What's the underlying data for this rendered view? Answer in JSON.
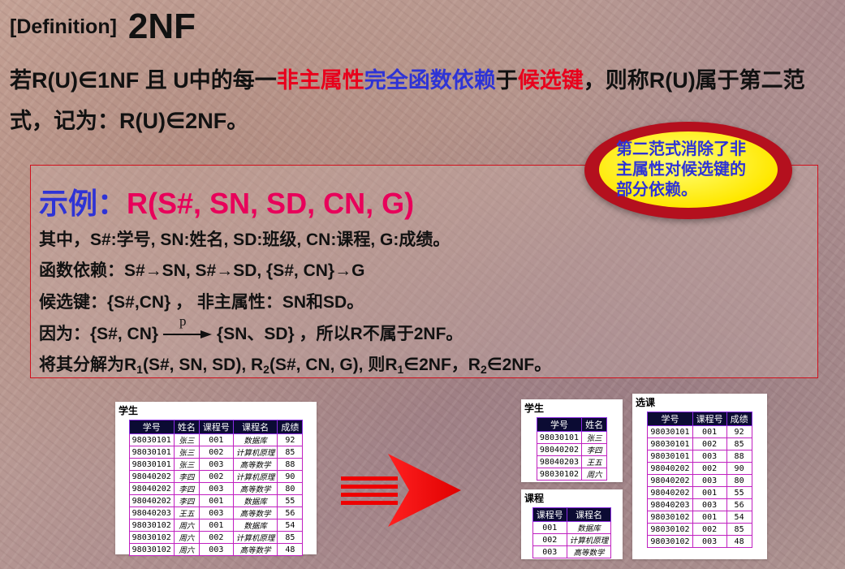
{
  "title": {
    "tag": "[Definition]",
    "name": "2NF"
  },
  "definition": {
    "p1": "若R(U)∈1NF 且 U中的每一",
    "p2": "非主属性",
    "p3": "完全函数依赖",
    "p4": "于",
    "p5": "候选键",
    "p6": "，则称R(U)属于第二范式，记为：R(U)∈2NF。"
  },
  "bubble": {
    "text": "第二范式消除了非主属性对候选键的部分依赖。"
  },
  "example": {
    "lead": "示例：",
    "relation": "R(S#, SN, SD, CN, G)",
    "line1": "其中，S#:学号, SN:姓名, SD:班级, CN:课程, G:成绩。",
    "line2": "函数依赖：S#→SN,  S#→SD, {S#, CN}→G",
    "line3": "候选键：{S#,CN} ， 非主属性：SN和SD。",
    "line4_a": "因为：{S#, CN}",
    "line4_p": "p",
    "line4_b": "{SN、SD} ，所以R不属于2NF。",
    "line5": {
      "a": "将其分解为R",
      "s1": "1",
      "b": "(S#, SN, SD), R",
      "s2": "2",
      "c": "(S#, CN, G), 则R",
      "s3": "1",
      "d": "∈2NF，R",
      "s4": "2",
      "e": "∈2NF。"
    }
  },
  "table_student": {
    "caption": "学生",
    "headers": [
      "学号",
      "姓名",
      "课程号",
      "课程名",
      "成绩"
    ],
    "rows": [
      [
        "98030101",
        "张三",
        "001",
        "数据库",
        "92"
      ],
      [
        "98030101",
        "张三",
        "002",
        "计算机原理",
        "85"
      ],
      [
        "98030101",
        "张三",
        "003",
        "高等数学",
        "88"
      ],
      [
        "98040202",
        "李四",
        "002",
        "计算机原理",
        "90"
      ],
      [
        "98040202",
        "李四",
        "003",
        "高等数学",
        "80"
      ],
      [
        "98040202",
        "李四",
        "001",
        "数据库",
        "55"
      ],
      [
        "98040203",
        "王五",
        "003",
        "高等数学",
        "56"
      ],
      [
        "98030102",
        "周六",
        "001",
        "数据库",
        "54"
      ],
      [
        "98030102",
        "周六",
        "002",
        "计算机原理",
        "85"
      ],
      [
        "98030102",
        "周六",
        "003",
        "高等数学",
        "48"
      ]
    ]
  },
  "table_student2": {
    "caption": "学生",
    "headers": [
      "学号",
      "姓名"
    ],
    "rows": [
      [
        "98030101",
        "张三"
      ],
      [
        "98040202",
        "李四"
      ],
      [
        "98040203",
        "王五"
      ],
      [
        "98030102",
        "周六"
      ]
    ]
  },
  "table_course": {
    "caption": "课程",
    "headers": [
      "课程号",
      "课程名"
    ],
    "rows": [
      [
        "001",
        "数据库"
      ],
      [
        "002",
        "计算机原理"
      ],
      [
        "003",
        "高等数学"
      ]
    ]
  },
  "table_select": {
    "caption": "选课",
    "headers": [
      "学号",
      "课程号",
      "成绩"
    ],
    "rows": [
      [
        "98030101",
        "001",
        "92"
      ],
      [
        "98030101",
        "002",
        "85"
      ],
      [
        "98030101",
        "003",
        "88"
      ],
      [
        "98040202",
        "002",
        "90"
      ],
      [
        "98040202",
        "003",
        "80"
      ],
      [
        "98040202",
        "001",
        "55"
      ],
      [
        "98040203",
        "003",
        "56"
      ],
      [
        "98030102",
        "001",
        "54"
      ],
      [
        "98030102",
        "002",
        "85"
      ],
      [
        "98030102",
        "003",
        "48"
      ]
    ]
  },
  "colors": {
    "red": "#e8001c",
    "blue": "#2e33d6",
    "pink": "#e8005a",
    "bubble_rim": "#b4101e",
    "bubble_fill": "#ffe800"
  },
  "icons": {
    "decompose_arrow": "right-arrow-icon"
  }
}
